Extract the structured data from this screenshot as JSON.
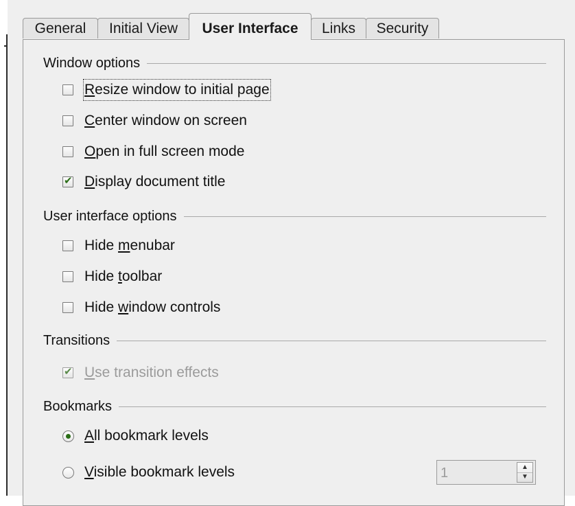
{
  "tabs": [
    {
      "label": "General",
      "active": false
    },
    {
      "label": "Initial View",
      "active": false
    },
    {
      "label": "User Interface",
      "active": true
    },
    {
      "label": "Links",
      "active": false
    },
    {
      "label": "Security",
      "active": false
    }
  ],
  "window_options": {
    "title": "Window options",
    "items": [
      {
        "pre": "",
        "mnemonic": "R",
        "post": "esize window to initial page",
        "checked": false
      },
      {
        "pre": "",
        "mnemonic": "C",
        "post": "enter window on screen",
        "checked": false
      },
      {
        "pre": "",
        "mnemonic": "O",
        "post": "pen in full screen mode",
        "checked": false
      },
      {
        "pre": "",
        "mnemonic": "D",
        "post": "isplay document title",
        "checked": true
      }
    ]
  },
  "ui_options": {
    "title": "User interface options",
    "items": [
      {
        "pre": "Hide ",
        "mnemonic": "m",
        "post": "enubar",
        "checked": false
      },
      {
        "pre": "Hide ",
        "mnemonic": "t",
        "post": "oolbar",
        "checked": false
      },
      {
        "pre": "Hide ",
        "mnemonic": "w",
        "post": "indow controls",
        "checked": false
      }
    ]
  },
  "transitions": {
    "title": "Transitions",
    "items": [
      {
        "pre": "",
        "mnemonic": "U",
        "post": "se transition effects",
        "checked": true,
        "disabled": true
      }
    ]
  },
  "bookmarks": {
    "title": "Bookmarks",
    "items": [
      {
        "pre": "",
        "mnemonic": "A",
        "post": "ll bookmark levels",
        "selected": true
      },
      {
        "pre": "",
        "mnemonic": "V",
        "post": "isible bookmark levels",
        "selected": false
      }
    ],
    "levels_value": "1"
  },
  "colors": {
    "check": "#2a6d16",
    "dialog_bg": "#efefef",
    "disabled_text": "#9b9b9b"
  },
  "icons": {
    "check": "check-mark-icon",
    "spin_up": "arrow-up-icon",
    "spin_down": "arrow-down-icon"
  }
}
